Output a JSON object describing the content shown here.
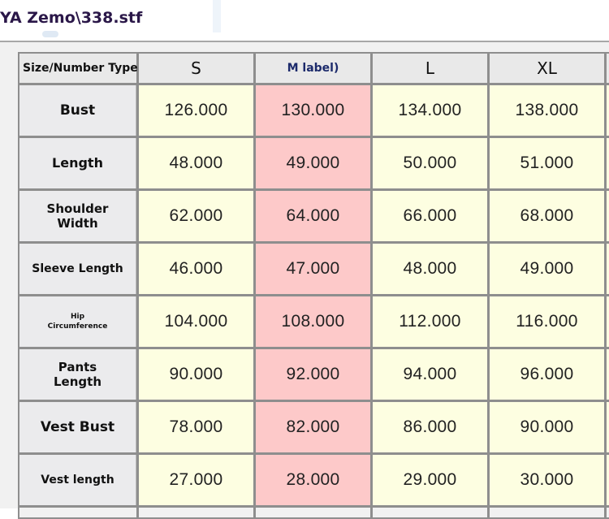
{
  "window": {
    "title": "YA Zemo\\338.stf"
  },
  "table": {
    "corner_label": "Size/Number Type",
    "columns": [
      "S",
      "M label)",
      "L",
      "XL"
    ],
    "rows": [
      {
        "label": "Bust",
        "values": [
          "126.000",
          "130.000",
          "134.000",
          "138.000"
        ]
      },
      {
        "label": "Length",
        "values": [
          "48.000",
          "49.000",
          "50.000",
          "51.000"
        ]
      },
      {
        "label": "Shoulder Width",
        "values": [
          "62.000",
          "64.000",
          "66.000",
          "68.000"
        ]
      },
      {
        "label": "Sleeve Length",
        "values": [
          "46.000",
          "47.000",
          "48.000",
          "49.000"
        ]
      },
      {
        "label": "Hip Circumference",
        "values": [
          "104.000",
          "108.000",
          "112.000",
          "116.000"
        ]
      },
      {
        "label": "Pants Length",
        "values": [
          "90.000",
          "92.000",
          "94.000",
          "96.000"
        ]
      },
      {
        "label": "Vest Bust",
        "values": [
          "78.000",
          "82.000",
          "86.000",
          "90.000"
        ]
      },
      {
        "label": "Vest length",
        "values": [
          "27.000",
          "28.000",
          "29.000",
          "30.000"
        ]
      }
    ]
  },
  "colors": {
    "highlight_column": "#fdc9c9",
    "cell_background": "#fdfee1",
    "header_background": "#e9e9e9",
    "grid_line": "#8e8e8e"
  }
}
